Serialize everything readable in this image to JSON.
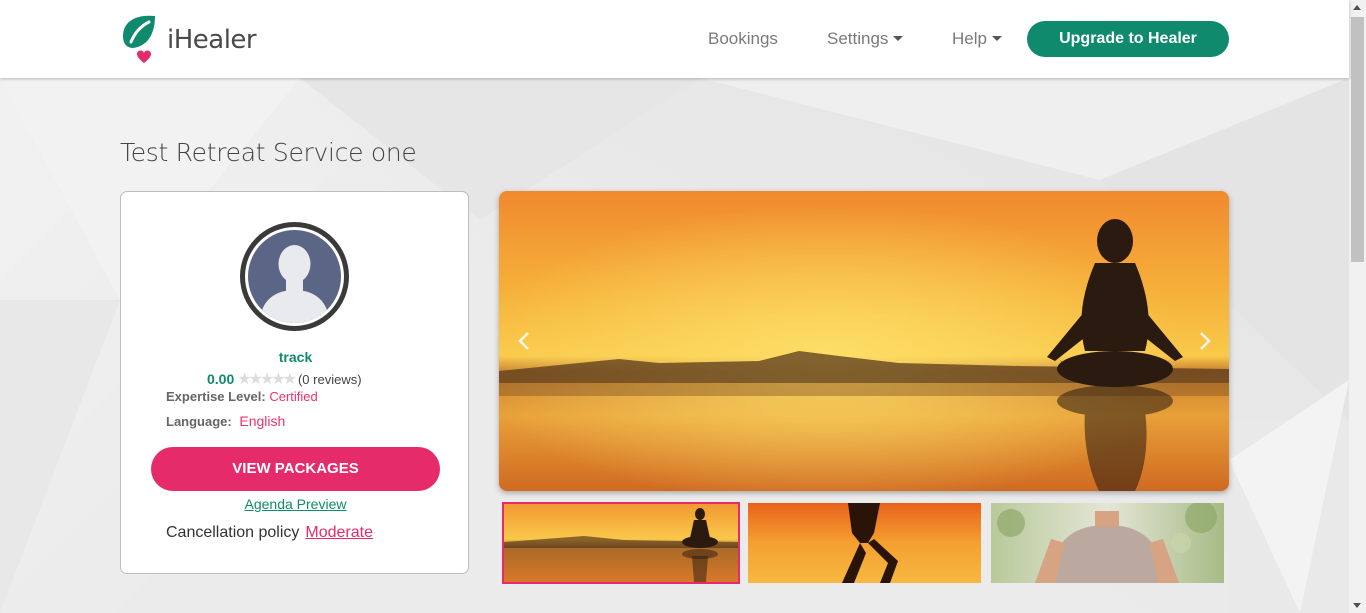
{
  "header": {
    "logo_text": "iHealer",
    "nav": {
      "bookings": "Bookings",
      "settings": "Settings",
      "help": "Help"
    },
    "upgrade_label": "Upgrade to Healer"
  },
  "page": {
    "title": "Test Retreat Service one"
  },
  "profile": {
    "name": "track",
    "rating": "0.00",
    "stars_filled": 0,
    "stars_total": 5,
    "reviews": "(0 reviews)",
    "expertise_label": "Expertise Level:",
    "expertise_value": "Certified",
    "language_label": "Language:",
    "language_value": "English",
    "view_packages_label": "VIEW PACKAGES",
    "agenda_label": "Agenda Preview",
    "cancellation_label": "Cancellation policy",
    "cancellation_value": "Moderate"
  },
  "carousel": {
    "prev_icon": "chevron-left-icon",
    "next_icon": "chevron-right-icon",
    "thumbnails": [
      "meditation-sunset",
      "yoga-silhouette",
      "man-meditating"
    ],
    "active_index": 0
  },
  "colors": {
    "brand_green": "#0f8a6c",
    "brand_pink": "#e52b6a"
  }
}
